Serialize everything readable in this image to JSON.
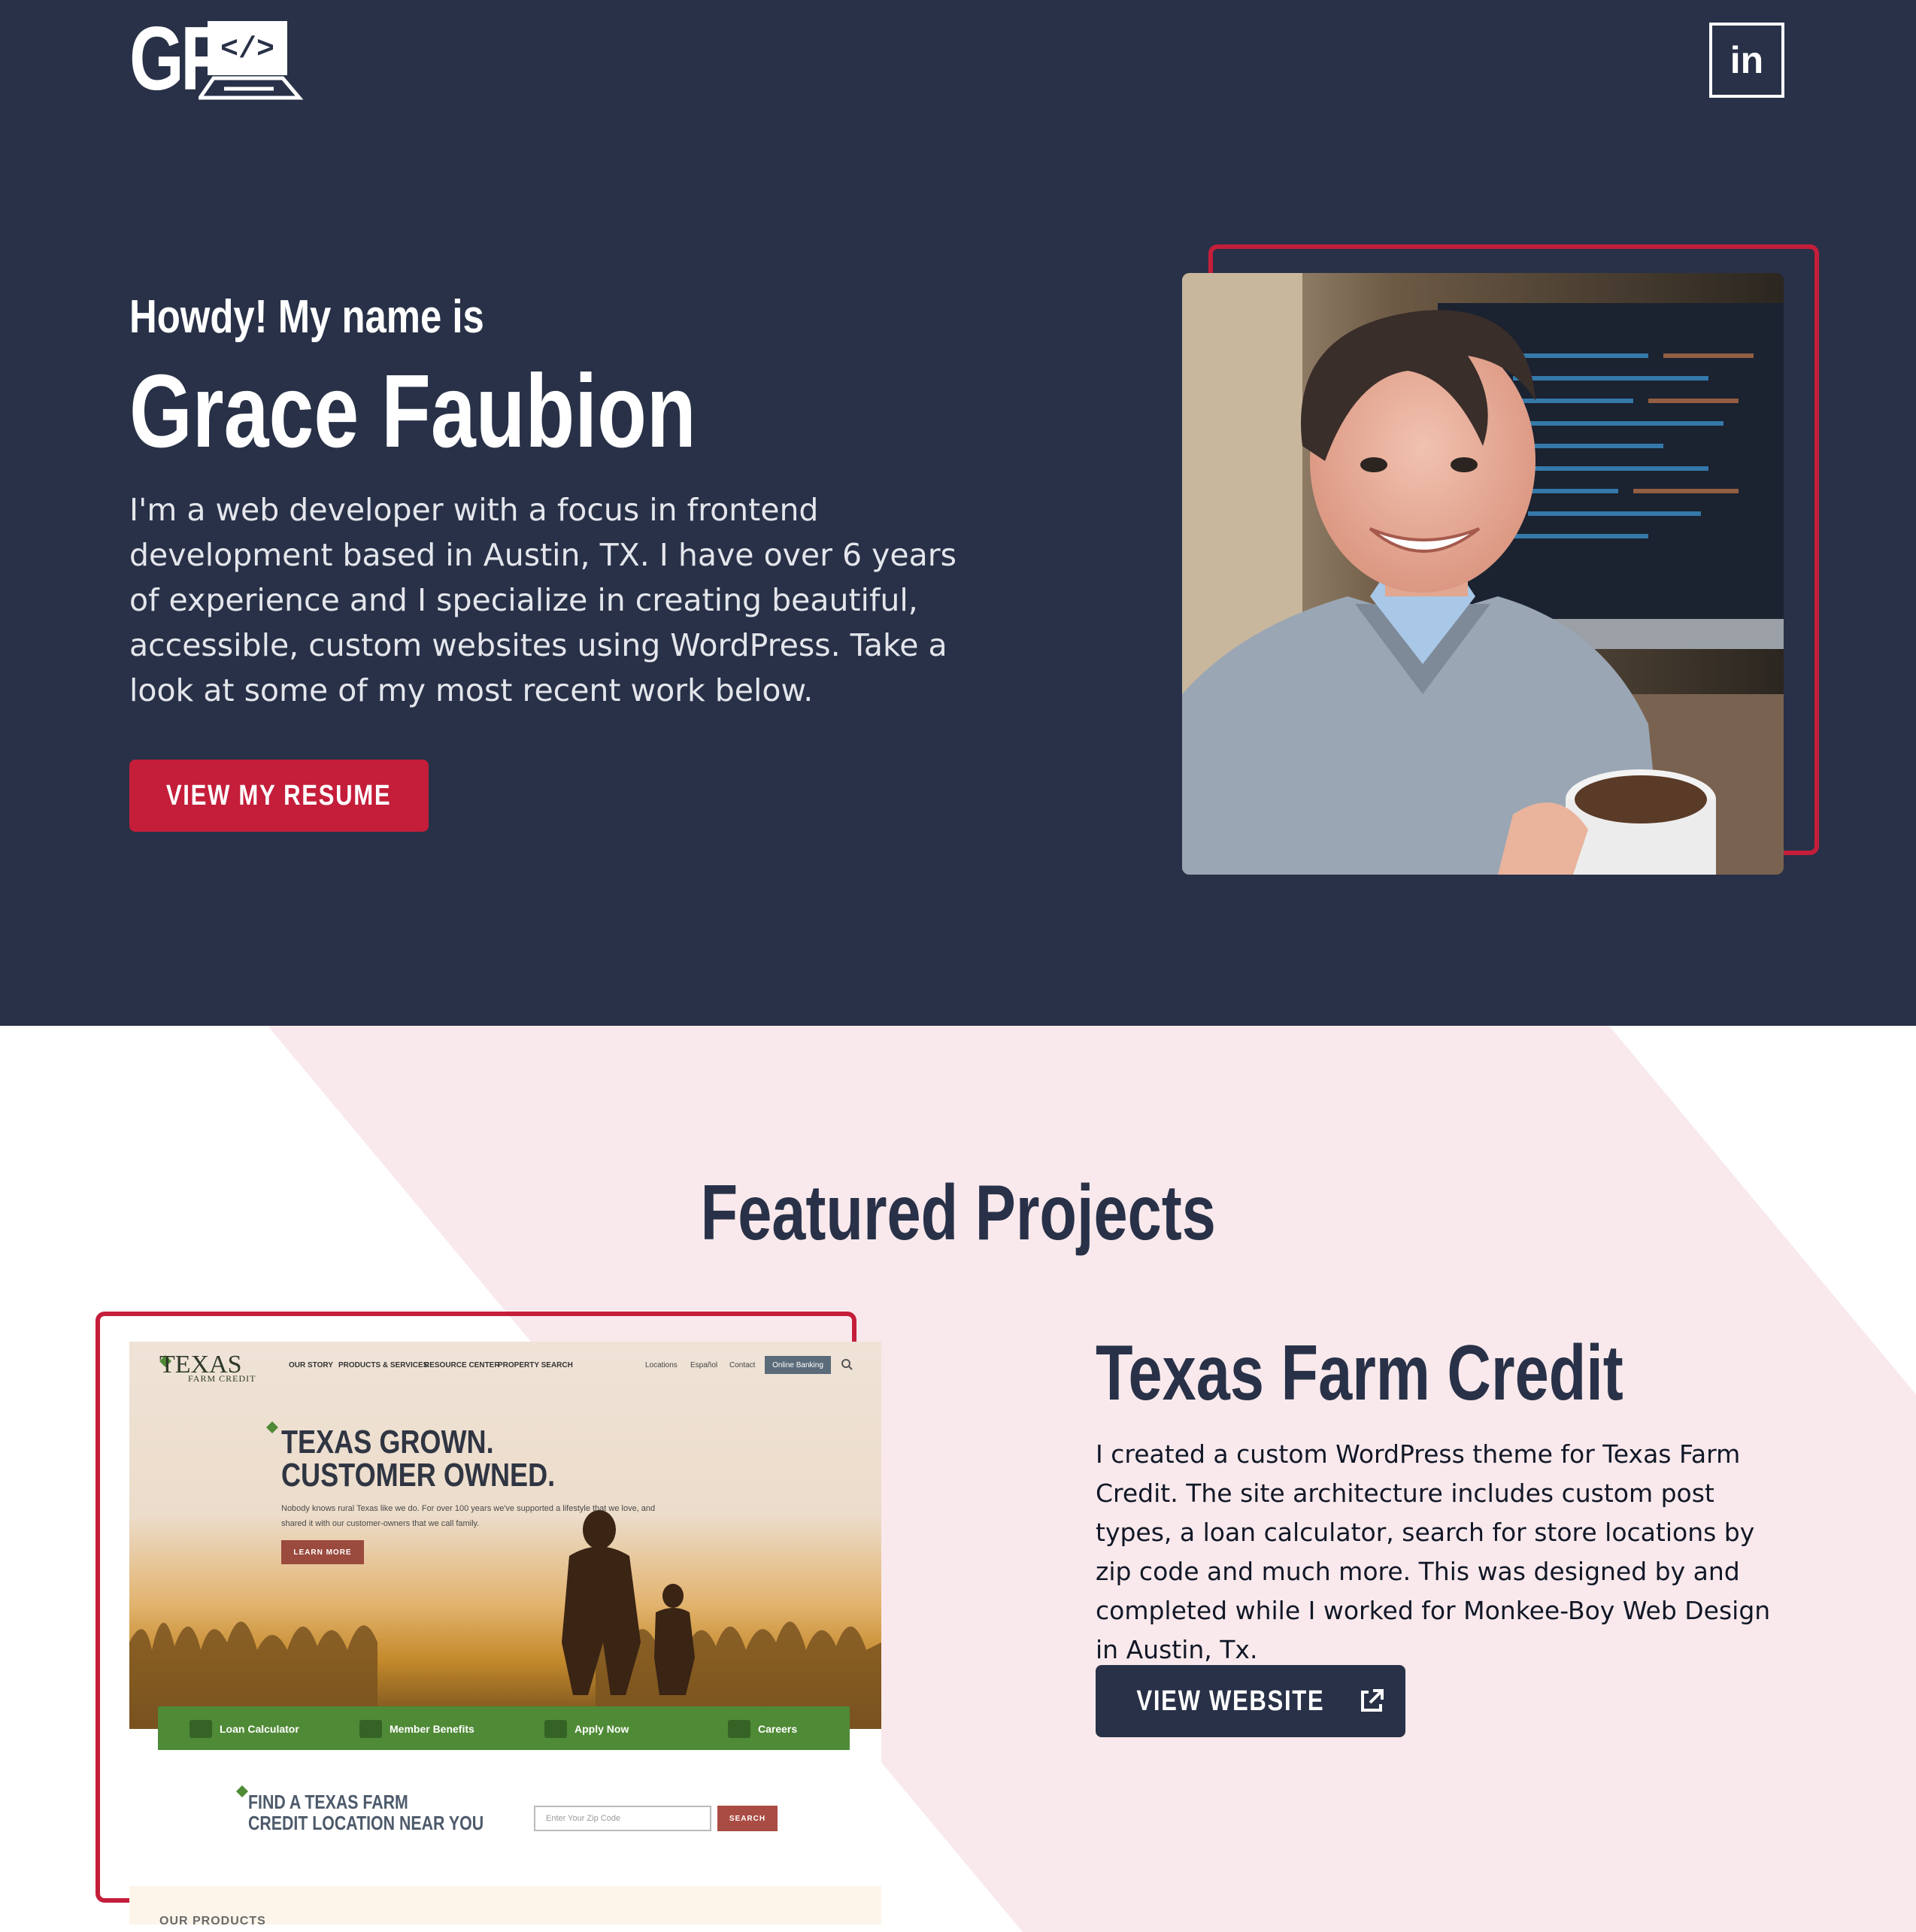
{
  "header": {
    "logo_letters": "GF",
    "logo_code_glyph": "</>",
    "linkedin_label": "in",
    "linkedin_icon": "linkedin-icon"
  },
  "hero": {
    "greeting": "Howdy! My name is",
    "name": "Grace Faubion",
    "intro": "I'm a web developer with a focus in frontend development based in Austin, TX. I have over 6 years of experience and I specialize in creating beautiful, accessible, custom websites using WordPress. Take a look at some of my most recent work below.",
    "resume_button": "VIEW MY RESUME",
    "photo_label": "portrait-photo"
  },
  "featured": {
    "title": "Featured Projects",
    "project": {
      "title": "Texas Farm Credit",
      "description": "I created a custom WordPress theme for Texas Farm Credit. The site architecture includes custom post types, a loan calculator, search for store locations by zip code and much more. This was designed by and completed while I worked for Monkee-Boy Web Design in Austin, Tx.",
      "button": "VIEW WEBSITE",
      "button_icon": "external-link-icon"
    },
    "screenshot": {
      "logo": "TEXAS",
      "logo_sub": "FARM CREDIT",
      "nav": [
        "OUR STORY",
        "PRODUCTS & SERVICES",
        "RESOURCE CENTER",
        "PROPERTY SEARCH"
      ],
      "util": [
        "Locations",
        "Español",
        "Contact"
      ],
      "banking": "Online Banking",
      "headline_1": "TEXAS GROWN.",
      "headline_2": "CUSTOMER OWNED.",
      "sub": "Nobody knows rural Texas like we do. For over 100 years we've supported a lifestyle that we love, and shared it with our customer-owners that we call family.",
      "learn_more": "LEARN MORE",
      "bar": [
        "Loan Calculator",
        "Member Benefits",
        "Apply Now",
        "Careers"
      ],
      "find_1": "FIND A TEXAS FARM",
      "find_2": "CREDIT LOCATION NEAR YOU",
      "zip_placeholder": "Enter Your Zip Code",
      "search": "SEARCH",
      "bottom": "OUR PRODUCTS"
    }
  },
  "colors": {
    "navy": "#283147",
    "accent_red": "#c41e3a",
    "pink_band": "#f9e9ec",
    "white": "#ffffff"
  }
}
